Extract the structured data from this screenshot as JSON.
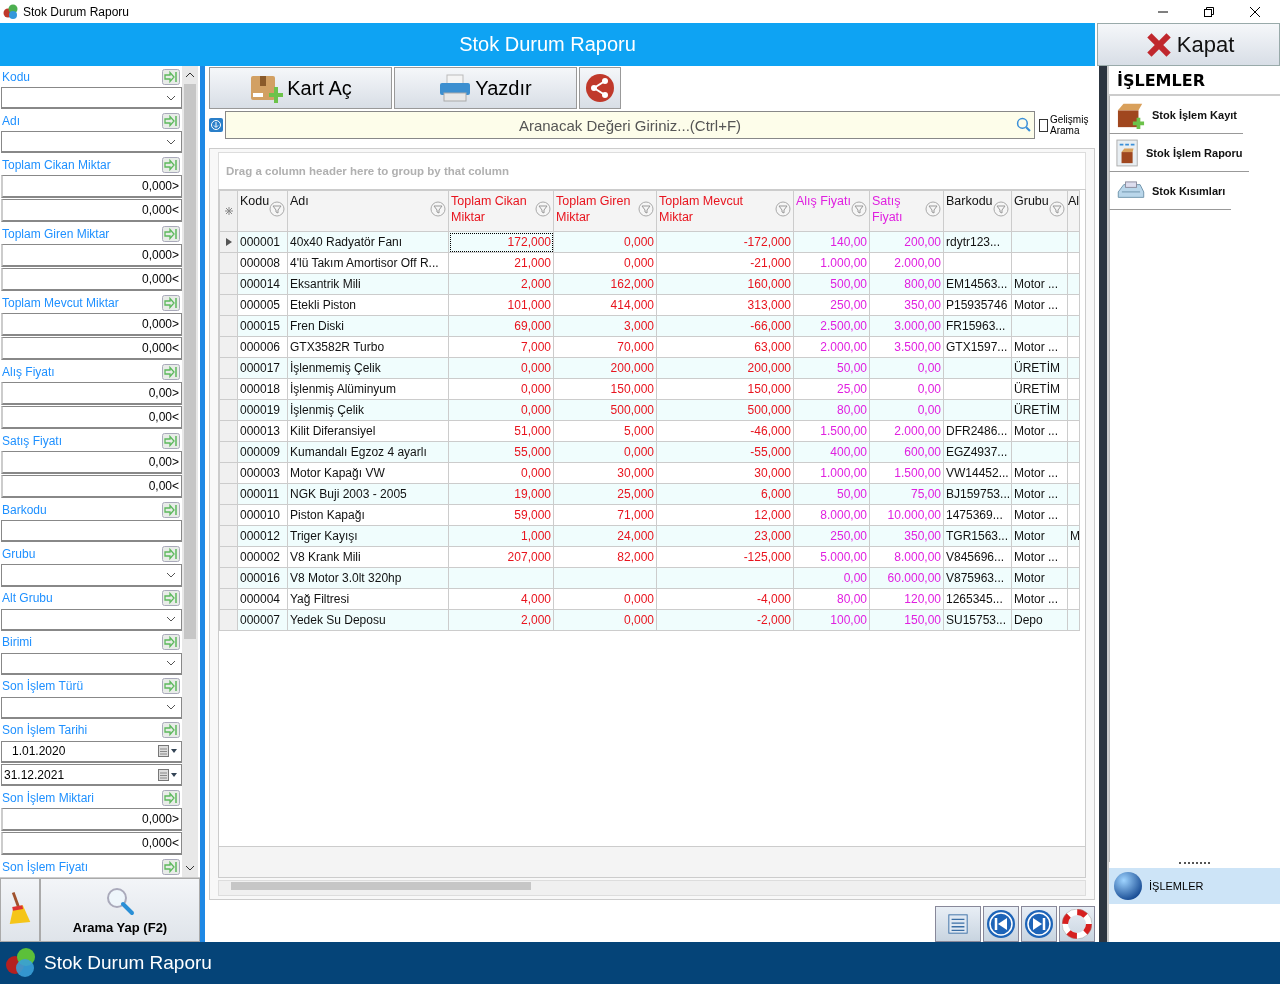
{
  "window": {
    "title": "Stok Durum Raporu"
  },
  "header": {
    "title": "Stok Durum Raporu",
    "close_label": "Kapat"
  },
  "filters": [
    {
      "label": "Kodu",
      "kind": "combo"
    },
    {
      "label": "Adı",
      "kind": "combo"
    },
    {
      "label": "Toplam Cikan Miktar",
      "kind": "range",
      "values": [
        "0,000>",
        "0,000<"
      ]
    },
    {
      "label": "Toplam Giren Miktar",
      "kind": "range",
      "values": [
        "0,000>",
        "0,000<"
      ]
    },
    {
      "label": "Toplam Mevcut Miktar",
      "kind": "range",
      "values": [
        "0,000>",
        "0,000<"
      ]
    },
    {
      "label": "Alış Fiyatı",
      "kind": "range",
      "values": [
        "0,00>",
        "0,00<"
      ]
    },
    {
      "label": "Satış Fiyatı",
      "kind": "range",
      "values": [
        "0,00>",
        "0,00<"
      ]
    },
    {
      "label": "Barkodu",
      "kind": "text"
    },
    {
      "label": "Grubu",
      "kind": "combo"
    },
    {
      "label": "Alt Grubu",
      "kind": "combo"
    },
    {
      "label": "Birimi",
      "kind": "combo"
    },
    {
      "label": "Son İşlem Türü",
      "kind": "combo"
    },
    {
      "label": "Son İşlem Tarihi",
      "kind": "dates",
      "values": [
        "1.01.2020",
        "31.12.2021"
      ]
    },
    {
      "label": "Son İşlem Miktari",
      "kind": "range",
      "values": [
        "0,000>",
        "0,000<"
      ]
    },
    {
      "label": "Son İşlem Fiyatı",
      "kind": "label"
    }
  ],
  "search_button": "Arama Yap (F2)",
  "toolbar": [
    {
      "label": "Kart Aç",
      "kind": "card"
    },
    {
      "label": "Yazdır",
      "kind": "print"
    },
    {
      "kind": "share"
    }
  ],
  "search": {
    "placeholder": "Aranacak Değeri Giriniz...(Ctrl+F)",
    "advanced_label": "Gelişmiş Arama",
    "advanced_checked": false
  },
  "grid": {
    "group_hint": "Drag a column header here to group by that column",
    "columns": [
      {
        "label": "Kodu",
        "kind": "text"
      },
      {
        "label": "Adı",
        "kind": "text"
      },
      {
        "label": "Toplam Cikan Miktar",
        "kind": "qty"
      },
      {
        "label": "Toplam Giren Miktar",
        "kind": "qty"
      },
      {
        "label": "Toplam Mevcut Miktar",
        "kind": "qty"
      },
      {
        "label": "Alış Fiyatı",
        "kind": "price"
      },
      {
        "label": "Satış Fiyatı",
        "kind": "price"
      },
      {
        "label": "Barkodu",
        "kind": "text"
      },
      {
        "label": "Grubu",
        "kind": "text"
      },
      {
        "label": "Al",
        "kind": "text"
      }
    ],
    "rows": [
      {
        "selected": true,
        "cells": [
          "000001",
          "40x40 Radyatör Fanı",
          "172,000",
          "0,000",
          "-172,000",
          "140,00",
          "200,00",
          "rdytr123...",
          null,
          null
        ]
      },
      {
        "selected": false,
        "cells": [
          "000008",
          "4'lü Takım Amortisor Off R...",
          "21,000",
          "0,000",
          "-21,000",
          "1.000,00",
          "2.000,00",
          null,
          null,
          null
        ]
      },
      {
        "selected": false,
        "cells": [
          "000014",
          "Eksantrik Mili",
          "2,000",
          "162,000",
          "160,000",
          "500,00",
          "800,00",
          "EM14563...",
          "Motor ...",
          null
        ]
      },
      {
        "selected": false,
        "cells": [
          "000005",
          "Etekli Piston",
          "101,000",
          "414,000",
          "313,000",
          "250,00",
          "350,00",
          "P15935746",
          "Motor ...",
          null
        ]
      },
      {
        "selected": false,
        "cells": [
          "000015",
          "Fren Diski",
          "69,000",
          "3,000",
          "-66,000",
          "2.500,00",
          "3.000,00",
          "FR15963...",
          null,
          null
        ]
      },
      {
        "selected": false,
        "cells": [
          "000006",
          "GTX3582R Turbo",
          "7,000",
          "70,000",
          "63,000",
          "2.000,00",
          "3.500,00",
          "GTX1597...",
          "Motor ...",
          null
        ]
      },
      {
        "selected": false,
        "cells": [
          "000017",
          "İşlenmemiş Çelik",
          "0,000",
          "200,000",
          "200,000",
          "50,00",
          "0,00",
          null,
          "ÜRETİM",
          null
        ]
      },
      {
        "selected": false,
        "cells": [
          "000018",
          "İşlenmiş  Alüminyum",
          "0,000",
          "150,000",
          "150,000",
          "25,00",
          "0,00",
          null,
          "ÜRETİM",
          null
        ]
      },
      {
        "selected": false,
        "cells": [
          "000019",
          "İşlenmiş Çelik",
          "0,000",
          "500,000",
          "500,000",
          "80,00",
          "0,00",
          null,
          "ÜRETİM",
          null
        ]
      },
      {
        "selected": false,
        "cells": [
          "000013",
          "Kilit Diferansiyel",
          "51,000",
          "5,000",
          "-46,000",
          "1.500,00",
          "2.000,00",
          "DFR2486...",
          "Motor ...",
          null
        ]
      },
      {
        "selected": false,
        "cells": [
          "000009",
          "Kumandalı Egzoz 4 ayarlı",
          "55,000",
          "0,000",
          "-55,000",
          "400,00",
          "600,00",
          "EGZ4937...",
          null,
          null
        ]
      },
      {
        "selected": false,
        "cells": [
          "000003",
          "Motor Kapağı VW",
          "0,000",
          "30,000",
          "30,000",
          "1.000,00",
          "1.500,00",
          "VW14452...",
          "Motor ...",
          null
        ]
      },
      {
        "selected": false,
        "cells": [
          "000011",
          "NGK Buji 2003 - 2005",
          "19,000",
          "25,000",
          "6,000",
          "50,00",
          "75,00",
          "BJ159753...",
          "Motor ...",
          null
        ]
      },
      {
        "selected": false,
        "cells": [
          "000010",
          "Piston Kapağı",
          "59,000",
          "71,000",
          "12,000",
          "8.000,00",
          "10.000,00",
          "1475369...",
          "Motor ...",
          null
        ]
      },
      {
        "selected": false,
        "cells": [
          "000012",
          "Triger Kayışı",
          "1,000",
          "24,000",
          "23,000",
          "250,00",
          "350,00",
          "TGR1563...",
          "Motor",
          "M"
        ]
      },
      {
        "selected": false,
        "cells": [
          "000002",
          "V8 Krank Mili",
          "207,000",
          "82,000",
          "-125,000",
          "5.000,00",
          "8.000,00",
          "V845696...",
          "Motor ...",
          null
        ]
      },
      {
        "selected": false,
        "cells": [
          "000016",
          "V8 Motor 3.0lt  320hp",
          null,
          null,
          null,
          "0,00",
          "60.000,00",
          "V875963...",
          "Motor",
          null
        ]
      },
      {
        "selected": false,
        "cells": [
          "000004",
          "Yağ Filtresi",
          "4,000",
          "0,000",
          "-4,000",
          "80,00",
          "120,00",
          "1265345...",
          "Motor ...",
          null
        ]
      },
      {
        "selected": false,
        "cells": [
          "000007",
          "Yedek Su Deposu",
          "2,000",
          "0,000",
          "-2,000",
          "100,00",
          "150,00",
          "SU15753...",
          "Depo",
          null
        ]
      }
    ]
  },
  "actions": {
    "title": "İŞLEMLER",
    "items": [
      {
        "label": "Stok İşlem Kayıt",
        "kind": "add"
      },
      {
        "label": "Stok İşlem Raporu",
        "kind": "report"
      },
      {
        "label": "Stok Kısımları",
        "kind": "register"
      }
    ],
    "nav": [
      {
        "label": "İŞLEMLER",
        "selected": true
      }
    ]
  },
  "status_bar": {
    "title": "Stok Durum Raporu"
  }
}
